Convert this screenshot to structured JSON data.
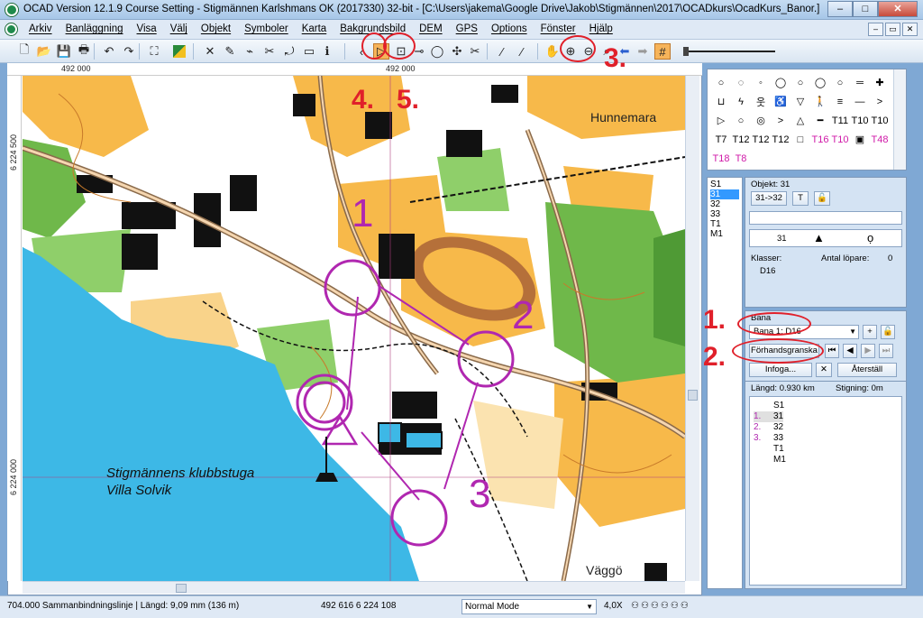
{
  "window": {
    "title": "OCAD Version 12.1.9  Course Setting - Stigmännen Karlshmans OK (2017330) 32-bit - [C:\\Users\\jakema\\Google Drive\\Jakob\\Stigmännen\\2017\\OCADkurs\\OcadKurs_Banor.]",
    "minimize": "–",
    "maximize": "□",
    "close": "✕"
  },
  "menu": {
    "items": [
      "Arkiv",
      "Banläggning",
      "Visa",
      "Välj",
      "Objekt",
      "Symboler",
      "Karta",
      "Bakgrundsbild",
      "DEM",
      "GPS",
      "Options",
      "Fönster",
      "Hjälp"
    ],
    "mdi": [
      "–",
      "▭",
      "✕"
    ]
  },
  "toolbar": {
    "icons": [
      "new-file-icon",
      "open-folder-icon",
      "save-icon",
      "print-icon",
      "undo-icon",
      "redo-icon",
      "fullscreen-icon",
      "color-icon",
      "delete-icon",
      "edit-icon",
      "brush-icon",
      "scissors-icon",
      "rotate-icon",
      "text-icon",
      "info-icon",
      "arrow-icon",
      "select-icon",
      "node-icon",
      "circle-icon",
      "cut-icon",
      "pan-icon",
      "zoom-in-icon",
      "zoom-out-icon",
      "zoom-icon",
      "back-icon",
      "forward-icon",
      "grid-icon"
    ]
  },
  "rulers": {
    "top_left": "492 000",
    "top_mid": "492 000",
    "left_top": "6 224 500",
    "left_bottom": "6 224 000"
  },
  "map": {
    "place_name": "Hunnemara",
    "club_line1": "Stigmännens klubbstuga",
    "club_line2": "Villa Solvik",
    "bottom_label": "Väggö",
    "controls": [
      "1",
      "2",
      "3"
    ]
  },
  "annotations": {
    "labels": [
      "1.",
      "2.",
      "3.",
      "4.",
      "5."
    ]
  },
  "symbols": {
    "row_labels": [
      "T11",
      "T10",
      "T10",
      "T7",
      "T12",
      "T12",
      "T16",
      "T10",
      "T48",
      "T18",
      "T8"
    ]
  },
  "course_list": {
    "items": [
      "S1",
      "31",
      "32",
      "33",
      "T1",
      "M1"
    ],
    "selected": "31"
  },
  "object_panel": {
    "header": "Objekt: 31",
    "relink_btn": "31->32",
    "t_btn": "T",
    "code": "31",
    "klasser_label": "Klasser:",
    "runners_label": "Antal löpare:",
    "runners_value": "0",
    "class_value": "D16"
  },
  "bana_panel": {
    "label": "Bana",
    "selected": "Bana 1: D16",
    "preview_btn": "Förhandsgranska",
    "insert_btn": "Infoga...",
    "reset_btn": "Återställ",
    "length": "Längd: 0.930 km",
    "climb": "Stigning: 0m"
  },
  "course_controls": [
    {
      "num": "",
      "code": "S1"
    },
    {
      "num": "1.",
      "code": "31"
    },
    {
      "num": "2.",
      "code": "32"
    },
    {
      "num": "3.",
      "code": "33"
    },
    {
      "num": "",
      "code": "T1"
    },
    {
      "num": "",
      "code": "M1"
    }
  ],
  "status": {
    "object": "704.000 Sammanbindningslinje  |  Längd: 9,09 mm (136 m)",
    "coords": "492 616   6 224 108",
    "mode": "Normal Mode",
    "zoom": "4,0X"
  },
  "colors": {
    "annotation_red": "#e0202a",
    "course_purple": "#b027b0",
    "water": "#3db8e6",
    "open_land": "#f7b94a",
    "forest_green": "#6fb84a"
  }
}
